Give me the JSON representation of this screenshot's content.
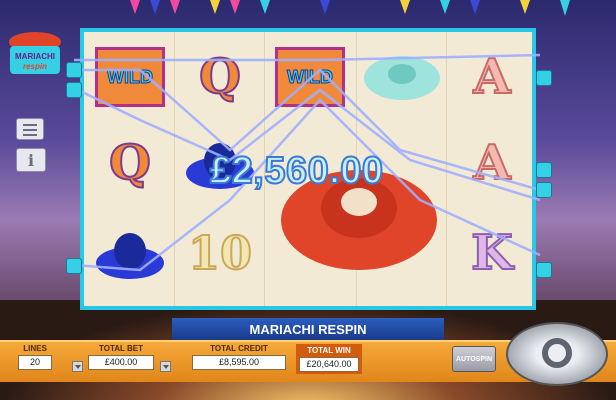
{
  "logo": {
    "line1": "MARIACHI",
    "line2": "respin"
  },
  "reels": [
    [
      "WILD",
      "Q",
      "sombrero-blue"
    ],
    [
      "Q",
      "sombrero-blue",
      "10"
    ],
    [
      "WILD",
      "sombrero-red",
      "sombrero-red"
    ],
    [
      "sombrero-teal",
      "",
      ""
    ],
    [
      "A",
      "A",
      "K"
    ]
  ],
  "wild_label": "WILD",
  "win_amount": "£2,560.00",
  "banner": "MARIACHI RESPIN",
  "panel": {
    "lines_label": "LINES",
    "lines_value": "20",
    "total_bet_label": "TOTAL BET",
    "total_bet_value": "£400.00",
    "total_credit_label": "TOTAL CREDIT",
    "total_credit_value": "£8,595.00",
    "total_win_label": "TOTAL WIN",
    "total_win_value": "£20,640.00"
  },
  "autospin_label": "AUTOSPIN",
  "colors": {
    "frame": "#29c7e6",
    "panel": "#f6a93a",
    "win_text": "#c8f0ff",
    "banner": "#2a5ec0"
  },
  "icons": {
    "menu": "menu-icon",
    "info": "info-icon",
    "spin": "spin-icon"
  }
}
